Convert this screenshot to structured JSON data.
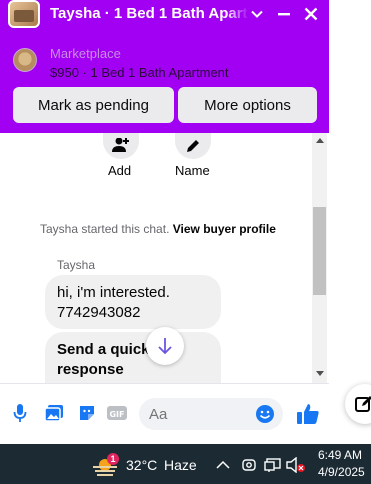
{
  "header": {
    "title": "Taysha · 1 Bed 1 Bath Apart",
    "marketplace_label": "Marketplace",
    "item": "$950 · 1 Bed 1 Bath Apartment",
    "pending_button": "Mark as pending",
    "more_button": "More options",
    "icons": [
      "chevron-down-icon",
      "minimize-icon",
      "close-icon"
    ],
    "accent_color": "#a100f2"
  },
  "actions": {
    "add_label": "Add",
    "name_label": "Name"
  },
  "conversation": {
    "system_prefix": "Taysha started this chat.",
    "system_link": "View buyer profile",
    "sender": "Taysha",
    "messages": [
      {
        "text": "hi, i'm interested. 7742943082"
      },
      {
        "text": "Send a quick response"
      }
    ]
  },
  "composer": {
    "placeholder": "Aa",
    "icons": [
      "microphone-icon",
      "photo-icon",
      "sticker-icon",
      "gif-icon",
      "emoji-icon",
      "thumbs-up-icon"
    ]
  },
  "taskbar": {
    "weather_badge": "1",
    "temperature": "32°C",
    "condition": "Haze",
    "time": "6:49 AM",
    "date": "4/9/2025"
  }
}
